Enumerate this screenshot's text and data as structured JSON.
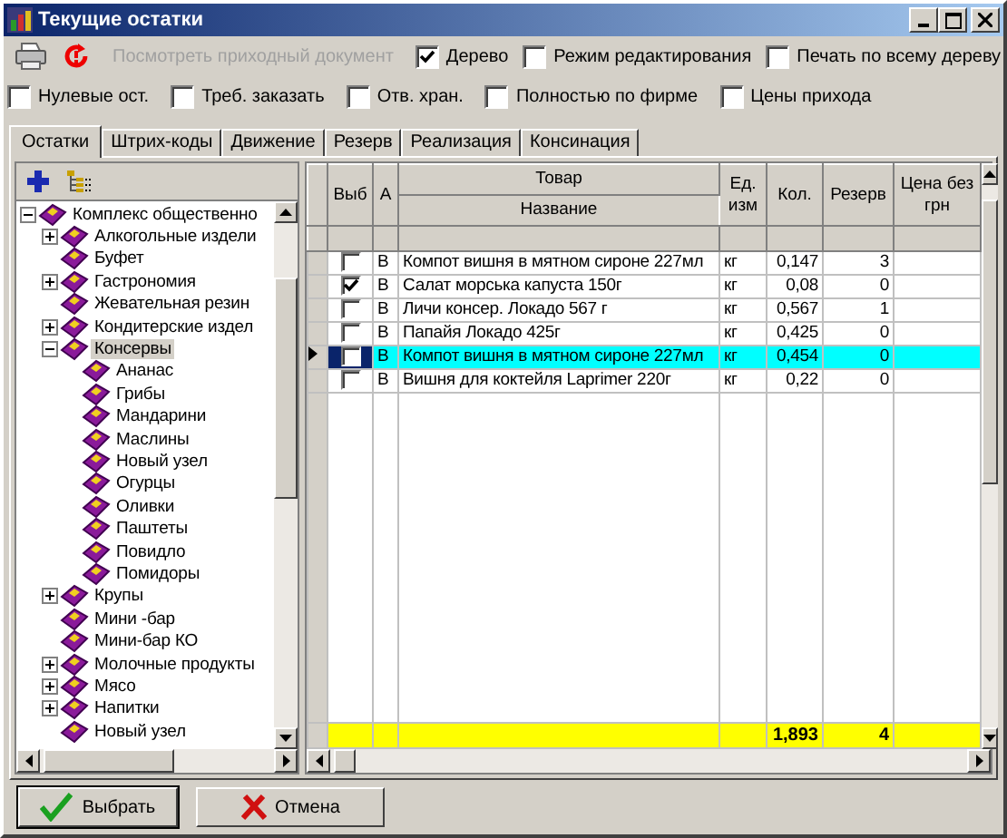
{
  "window": {
    "title": "Текущие остатки"
  },
  "toolbar": {
    "link": {
      "label": "Посмотреть приходный документ",
      "disabled": true
    },
    "options": [
      {
        "label": "Дерево",
        "checked": true
      },
      {
        "label": "Режим редактирования",
        "checked": false
      },
      {
        "label": "Печать по всему дереву",
        "checked": false
      }
    ]
  },
  "filters": [
    {
      "label": "Нулевые ост.",
      "checked": false
    },
    {
      "label": "Треб. заказать",
      "checked": false
    },
    {
      "label": "Отв. хран.",
      "checked": false
    },
    {
      "label": "Полностью по фирме",
      "checked": false
    },
    {
      "label": "Цены прихода",
      "checked": false
    }
  ],
  "tabs": [
    {
      "label": "Остатки",
      "selected": true
    },
    {
      "label": "Штрих-коды",
      "selected": false
    },
    {
      "label": "Движение",
      "selected": false
    },
    {
      "label": "Резерв",
      "selected": false
    },
    {
      "label": "Реализация",
      "selected": false
    },
    {
      "label": "Консинация",
      "selected": false
    }
  ],
  "tree": [
    {
      "label": "Комплекс общественно",
      "expanded": true,
      "selected": false,
      "children": [
        {
          "label": "Алкогольные издели",
          "expanded": false,
          "selected": false
        },
        {
          "label": "Буфет",
          "selected": false
        },
        {
          "label": "Гастрономия",
          "expanded": false,
          "selected": false
        },
        {
          "label": "Жевательная резин",
          "selected": false
        },
        {
          "label": "Кондитерские издел",
          "expanded": false,
          "selected": false
        },
        {
          "label": "Консервы",
          "expanded": true,
          "selected": true,
          "children": [
            {
              "label": "Ананас",
              "selected": false
            },
            {
              "label": "Грибы",
              "selected": false
            },
            {
              "label": "Мандарини",
              "selected": false
            },
            {
              "label": "Маслины",
              "selected": false
            },
            {
              "label": "Новый узел",
              "selected": false
            },
            {
              "label": "Огурцы",
              "selected": false
            },
            {
              "label": "Оливки",
              "selected": false
            },
            {
              "label": "Паштеты",
              "selected": false
            },
            {
              "label": "Повидло",
              "selected": false
            },
            {
              "label": "Помидоры",
              "selected": false
            }
          ]
        },
        {
          "label": "Крупы",
          "expanded": false,
          "selected": false
        },
        {
          "label": "Мини -бар",
          "selected": false
        },
        {
          "label": "Мини-бар КО",
          "selected": false
        },
        {
          "label": "Молочные продукты",
          "expanded": false,
          "selected": false
        },
        {
          "label": "Мясо",
          "expanded": false,
          "selected": false
        },
        {
          "label": "Напитки",
          "expanded": false,
          "selected": false
        },
        {
          "label": "Новый узел",
          "selected": false
        }
      ]
    }
  ],
  "table": {
    "group_header": "Товар",
    "columns": [
      {
        "lines": [
          "Выб"
        ]
      },
      {
        "lines": [
          "А"
        ]
      },
      {
        "lines": [
          "Название"
        ]
      },
      {
        "lines": [
          "Ед.",
          "изм"
        ]
      },
      {
        "lines": [
          "Кол."
        ]
      },
      {
        "lines": [
          "Резерв"
        ]
      },
      {
        "lines": [
          "Цена без",
          "грн"
        ]
      }
    ],
    "rows": [
      {
        "checked": false,
        "a": "В",
        "name": "Компот вишня в мятном сироне 227мл",
        "unit": "кг",
        "qty": "0,147",
        "reserve": "3",
        "selected": false
      },
      {
        "checked": true,
        "a": "В",
        "name": "Салат морська капуста 150г",
        "unit": "кг",
        "qty": "0,08",
        "reserve": "0",
        "selected": false
      },
      {
        "checked": false,
        "a": "В",
        "name": "Личи консер. Локадо 567 г",
        "unit": "кг",
        "qty": "0,567",
        "reserve": "1",
        "selected": false
      },
      {
        "checked": false,
        "a": "В",
        "name": "Папайя Локадо  425г",
        "unit": "кг",
        "qty": "0,425",
        "reserve": "0",
        "selected": false
      },
      {
        "checked": false,
        "a": "В",
        "name": "Компот вишня в мятном сироне 227мл",
        "unit": "кг",
        "qty": "0,454",
        "reserve": "0",
        "selected": true
      },
      {
        "checked": false,
        "a": "В",
        "name": "Вишня для коктейля Laprimer 220г",
        "unit": "кг",
        "qty": "0,22",
        "reserve": "0",
        "selected": false
      }
    ],
    "totals": {
      "qty": "1,893",
      "reserve": "4"
    }
  },
  "buttons": [
    {
      "label": "Выбрать",
      "kind": "ok"
    },
    {
      "label": "Отмена",
      "kind": "cancel"
    }
  ]
}
